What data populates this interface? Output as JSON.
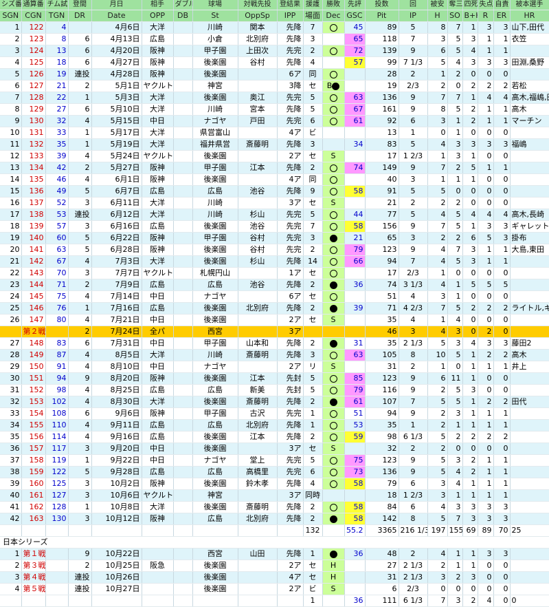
{
  "header1": [
    "シズ番",
    "通算番",
    "チム試",
    "登間",
    "月日",
    "相手",
    "ダブル",
    "球場",
    "対戦先投",
    "登結果",
    "援護",
    "勝敗",
    "先評",
    "投数",
    "回",
    "被安",
    "奪三",
    "四死",
    "失点",
    "自責",
    "被本選手"
  ],
  "header2": [
    "SGN",
    "CGN",
    "TGN",
    "DR",
    "Date",
    "OPP",
    "DB",
    "St",
    "OppSp",
    "IPP",
    "場面",
    "Dec",
    "GSC",
    "Pit",
    "IP",
    "H",
    "SO",
    "B+H",
    "R",
    "ER",
    "HR"
  ],
  "regular_rows": [
    [
      "1",
      "122",
      "4",
      "",
      "4月6日",
      "大洋",
      "",
      "川崎",
      "関本",
      "先降",
      "7",
      "○",
      "45",
      "89",
      "5",
      "8",
      "7",
      "1",
      "3",
      "3",
      "山下,田代"
    ],
    [
      "2",
      "123",
      "8",
      "6",
      "4月13日",
      "広島",
      "",
      "小倉",
      "北別府",
      "先降",
      "3",
      "",
      "65",
      "118",
      "7",
      "3",
      "5",
      "3",
      "1",
      "1",
      "衣笠"
    ],
    [
      "3",
      "124",
      "13",
      "6",
      "4月20日",
      "阪神",
      "",
      "甲子園",
      "上田次",
      "先完",
      "2",
      "○",
      "72",
      "139",
      "9",
      "6",
      "5",
      "4",
      "1",
      "1",
      ""
    ],
    [
      "4",
      "125",
      "18",
      "6",
      "4月27日",
      "阪神",
      "",
      "後楽園",
      "谷村",
      "先降",
      "4",
      "",
      "57",
      "99",
      "7 1/3",
      "5",
      "4",
      "3",
      "3",
      "3",
      "田淵,桑野"
    ],
    [
      "5",
      "126",
      "19",
      "連投",
      "4月28日",
      "阪神",
      "",
      "後楽園",
      "",
      "6ア",
      "同",
      "○",
      "",
      "28",
      "2",
      "1",
      "2",
      "0",
      "0",
      "0",
      ""
    ],
    [
      "6",
      "127",
      "21",
      "2",
      "5月1日",
      "ヤクルト",
      "",
      "神宮",
      "",
      "3降",
      "セ",
      "B●",
      "",
      "19",
      "2/3",
      "2",
      "0",
      "2",
      "2",
      "2",
      "若松"
    ],
    [
      "7",
      "128",
      "22",
      "1",
      "5月3日",
      "大洋",
      "",
      "後楽園",
      "奥江",
      "先完",
      "5",
      "○",
      "63",
      "136",
      "9",
      "7",
      "7",
      "1",
      "4",
      "4",
      "高木,福嶋,田代"
    ],
    [
      "8",
      "129",
      "27",
      "6",
      "5月10日",
      "大洋",
      "",
      "川崎",
      "宮本",
      "先降",
      "5",
      "○",
      "67",
      "161",
      "9",
      "8",
      "5",
      "2",
      "1",
      "1",
      "高木"
    ],
    [
      "9",
      "130",
      "32",
      "4",
      "5月15日",
      "中日",
      "",
      "ナゴヤ",
      "戸田",
      "先完",
      "6",
      "○",
      "61",
      "92",
      "6",
      "3",
      "1",
      "2",
      "1",
      "1",
      "マーチン"
    ],
    [
      "10",
      "131",
      "33",
      "1",
      "5月17日",
      "大洋",
      "",
      "県営富山",
      "",
      "4ア",
      "ビ",
      "",
      "",
      "13",
      "1",
      "0",
      "1",
      "0",
      "0",
      "0",
      ""
    ],
    [
      "11",
      "132",
      "35",
      "1",
      "5月19日",
      "大洋",
      "",
      "福井県営",
      "斎藤明",
      "先降",
      "3",
      "",
      "34",
      "83",
      "5",
      "4",
      "3",
      "3",
      "3",
      "3",
      "福嶋"
    ],
    [
      "12",
      "133",
      "39",
      "4",
      "5月24日",
      "ヤクルト",
      "",
      "後楽園",
      "",
      "2ア",
      "セ",
      "S",
      "",
      "17",
      "1 2/3",
      "1",
      "3",
      "1",
      "0",
      "0",
      ""
    ],
    [
      "13",
      "134",
      "42",
      "2",
      "5月27日",
      "阪神",
      "",
      "甲子園",
      "江本",
      "先降",
      "2",
      "○",
      "74",
      "149",
      "9",
      "7",
      "2",
      "5",
      "1",
      "1",
      ""
    ],
    [
      "14",
      "135",
      "46",
      "4",
      "6月1日",
      "阪神",
      "",
      "後楽園",
      "",
      "4ア",
      "同",
      "○",
      "",
      "40",
      "3",
      "1",
      "1",
      "1",
      "0",
      "0",
      ""
    ],
    [
      "15",
      "136",
      "49",
      "5",
      "6月7日",
      "広島",
      "",
      "広島",
      "池谷",
      "先降",
      "9",
      "○",
      "58",
      "91",
      "5",
      "5",
      "0",
      "0",
      "0",
      "0",
      ""
    ],
    [
      "16",
      "137",
      "52",
      "3",
      "6月11日",
      "大洋",
      "",
      "川崎",
      "",
      "3ア",
      "セ",
      "S",
      "",
      "21",
      "2",
      "2",
      "2",
      "0",
      "0",
      "0",
      ""
    ],
    [
      "17",
      "138",
      "53",
      "連投",
      "6月12日",
      "大洋",
      "",
      "川崎",
      "杉山",
      "先完",
      "5",
      "○",
      "44",
      "77",
      "5",
      "4",
      "5",
      "4",
      "4",
      "4",
      "高木,長崎"
    ],
    [
      "18",
      "139",
      "57",
      "3",
      "6月16日",
      "広島",
      "",
      "後楽園",
      "池谷",
      "先完",
      "7",
      "○",
      "58",
      "156",
      "9",
      "7",
      "5",
      "1",
      "3",
      "3",
      "ギャレット"
    ],
    [
      "19",
      "140",
      "60",
      "5",
      "6月22日",
      "阪神",
      "",
      "甲子園",
      "谷村",
      "先完",
      "3",
      "●",
      "21",
      "65",
      "3",
      "2",
      "2",
      "6",
      "5",
      "3",
      "掛布"
    ],
    [
      "20",
      "141",
      "63",
      "5",
      "6月28日",
      "阪神",
      "",
      "後楽園",
      "谷村",
      "先完",
      "2",
      "○",
      "79",
      "123",
      "9",
      "4",
      "7",
      "3",
      "1",
      "1",
      "大島,東田"
    ],
    [
      "21",
      "142",
      "67",
      "4",
      "7月3日",
      "大洋",
      "",
      "後楽園",
      "杉山",
      "先降",
      "14",
      "○",
      "66",
      "94",
      "7",
      "4",
      "5",
      "3",
      "1",
      "1",
      ""
    ],
    [
      "22",
      "143",
      "70",
      "3",
      "7月7日",
      "ヤクルト",
      "",
      "札幌円山",
      "",
      "1ア",
      "セ",
      "○",
      "",
      "17",
      "2/3",
      "1",
      "0",
      "0",
      "0",
      "0",
      ""
    ],
    [
      "23",
      "144",
      "71",
      "2",
      "7月9日",
      "広島",
      "",
      "広島",
      "池谷",
      "先降",
      "2",
      "●",
      "36",
      "74",
      "3 1/3",
      "4",
      "1",
      "5",
      "5",
      "5",
      ""
    ],
    [
      "24",
      "145",
      "75",
      "4",
      "7月14日",
      "中日",
      "",
      "ナゴヤ",
      "",
      "6ア",
      "セ",
      "○",
      "",
      "51",
      "4",
      "3",
      "1",
      "0",
      "0",
      "0",
      ""
    ],
    [
      "25",
      "146",
      "76",
      "1",
      "7月16日",
      "広島",
      "",
      "後楽園",
      "北別府",
      "先降",
      "2",
      "●",
      "39",
      "71",
      "4 2/3",
      "7",
      "5",
      "2",
      "2",
      "2",
      "ライトル,ギャレット"
    ],
    [
      "26",
      "147",
      "80",
      "4",
      "7月21日",
      "中日",
      "",
      "後楽園",
      "",
      "2ア",
      "セ",
      "S",
      "",
      "35",
      "4",
      "1",
      "4",
      "0",
      "0",
      "0",
      ""
    ]
  ],
  "allstar_row": [
    "",
    "第２戦",
    "",
    "2",
    "7月24日",
    "全パ",
    "",
    "西宮",
    "",
    "3ア",
    "",
    "",
    "",
    "46",
    "3",
    "4",
    "3",
    "0",
    "2",
    "0",
    ""
  ],
  "regular_rows2": [
    [
      "27",
      "148",
      "83",
      "6",
      "7月31日",
      "中日",
      "",
      "甲子園",
      "山本和",
      "先降",
      "2",
      "●",
      "31",
      "35",
      "2 1/3",
      "5",
      "3",
      "4",
      "3",
      "3",
      "藤田2"
    ],
    [
      "28",
      "149",
      "87",
      "4",
      "8月5日",
      "大洋",
      "",
      "川崎",
      "斎藤明",
      "先降",
      "3",
      "○",
      "63",
      "105",
      "8",
      "10",
      "5",
      "1",
      "2",
      "2",
      "高木"
    ],
    [
      "29",
      "150",
      "91",
      "4",
      "8月10日",
      "中日",
      "",
      "ナゴヤ",
      "",
      "2ア",
      "リ",
      "S",
      "",
      "31",
      "2",
      "1",
      "0",
      "1",
      "1",
      "1",
      "井上"
    ],
    [
      "30",
      "151",
      "94",
      "9",
      "8月20日",
      "阪神",
      "",
      "後楽園",
      "江本",
      "先封",
      "5",
      "○",
      "85",
      "123",
      "9",
      "6",
      "11",
      "1",
      "0",
      "0",
      ""
    ],
    [
      "31",
      "152",
      "98",
      "4",
      "8月25日",
      "広島",
      "",
      "広島",
      "新美",
      "先封",
      "5",
      "○",
      "79",
      "116",
      "9",
      "2",
      "5",
      "3",
      "0",
      "0",
      ""
    ],
    [
      "32",
      "153",
      "102",
      "4",
      "8月30日",
      "大洋",
      "",
      "後楽園",
      "斎藤明",
      "先降",
      "2",
      "●",
      "61",
      "107",
      "7",
      "5",
      "5",
      "1",
      "2",
      "2",
      "田代"
    ],
    [
      "33",
      "154",
      "108",
      "6",
      "9月6日",
      "阪神",
      "",
      "甲子園",
      "古沢",
      "先完",
      "1",
      "○",
      "51",
      "94",
      "9",
      "2",
      "3",
      "1",
      "1",
      "1",
      ""
    ],
    [
      "34",
      "155",
      "110",
      "4",
      "9月11日",
      "広島",
      "",
      "広島",
      "北別府",
      "先降",
      "1",
      "○",
      "53",
      "35",
      "1",
      "2",
      "1",
      "1",
      "1",
      "1",
      ""
    ],
    [
      "35",
      "156",
      "114",
      "4",
      "9月16日",
      "広島",
      "",
      "後楽園",
      "江本",
      "先降",
      "2",
      "○",
      "59",
      "98",
      "6 1/3",
      "5",
      "2",
      "2",
      "2",
      "2",
      ""
    ],
    [
      "36",
      "157",
      "117",
      "3",
      "9月20日",
      "中日",
      "",
      "後楽園",
      "",
      "3ア",
      "セ",
      "S",
      "",
      "32",
      "2",
      "2",
      "0",
      "0",
      "0",
      "0",
      ""
    ],
    [
      "37",
      "158",
      "119",
      "1",
      "9月22日",
      "中日",
      "",
      "ナゴヤ",
      "堂上",
      "先完",
      "5",
      "○",
      "75",
      "123",
      "9",
      "5",
      "3",
      "2",
      "1",
      "1",
      ""
    ],
    [
      "38",
      "159",
      "122",
      "5",
      "9月28日",
      "広島",
      "",
      "広島",
      "高橋里",
      "先完",
      "6",
      "○",
      "73",
      "136",
      "9",
      "5",
      "4",
      "2",
      "1",
      "1",
      ""
    ],
    [
      "39",
      "160",
      "125",
      "3",
      "10月2日",
      "阪神",
      "",
      "後楽園",
      "鈴木孝",
      "先降",
      "4",
      "○",
      "58",
      "79",
      "6",
      "3",
      "4",
      "1",
      "1",
      "1",
      ""
    ],
    [
      "40",
      "161",
      "127",
      "3",
      "10月6日",
      "ヤクルト",
      "",
      "神宮",
      "",
      "3ア",
      "同時",
      "",
      "",
      "18",
      "1 2/3",
      "3",
      "1",
      "1",
      "1",
      "1",
      ""
    ],
    [
      "41",
      "162",
      "128",
      "1",
      "10月8日",
      "大洋",
      "",
      "後楽園",
      "斎藤明",
      "先降",
      "2",
      "○",
      "58",
      "84",
      "6",
      "4",
      "3",
      "3",
      "3",
      "3",
      ""
    ],
    [
      "42",
      "163",
      "130",
      "3",
      "10月12日",
      "阪神",
      "",
      "広島",
      "北別府",
      "先降",
      "2",
      "●",
      "58",
      "142",
      "8",
      "5",
      "7",
      "3",
      "3",
      "3",
      ""
    ]
  ],
  "regular_total": [
    "",
    "",
    "",
    "",
    "",
    "",
    "",
    "",
    "",
    "",
    "132",
    "",
    "55.2",
    "3365",
    "216 1/3",
    "197",
    "155",
    "69",
    "89",
    "70",
    "25"
  ],
  "series_title": "日本シリーズ",
  "series_rows": [
    [
      "1",
      "第１戦",
      "",
      "9",
      "10月22日",
      "",
      "",
      "西宮",
      "山田",
      "先降",
      "1",
      "●",
      "36",
      "48",
      "2",
      "4",
      "1",
      "1",
      "3",
      "3",
      ""
    ],
    [
      "2",
      "第３戦",
      "",
      "2",
      "10月25日",
      "阪急",
      "",
      "後楽園",
      "",
      "2ア",
      "セ",
      "H",
      "",
      "27",
      "2 1/3",
      "2",
      "1",
      "1",
      "0",
      "0",
      ""
    ],
    [
      "3",
      "第４戦",
      "",
      "連投",
      "10月26日",
      "",
      "",
      "後楽園",
      "",
      "4ア",
      "セ",
      "H",
      "",
      "31",
      "2 1/3",
      "3",
      "2",
      "3",
      "0",
      "0",
      ""
    ],
    [
      "4",
      "第５戦",
      "",
      "連投",
      "10月27日",
      "",
      "",
      "後楽園",
      "",
      "2ア",
      "ビ",
      "S",
      "",
      "6",
      "2/3",
      "0",
      "0",
      "0",
      "0",
      "0",
      ""
    ]
  ],
  "series_total": [
    "",
    "",
    "",
    "",
    "",
    "",
    "",
    "",
    "",
    "",
    "1",
    "",
    "36",
    "111",
    "6 1/3",
    "7",
    "3",
    "2",
    "4",
    "0",
    "0"
  ]
}
